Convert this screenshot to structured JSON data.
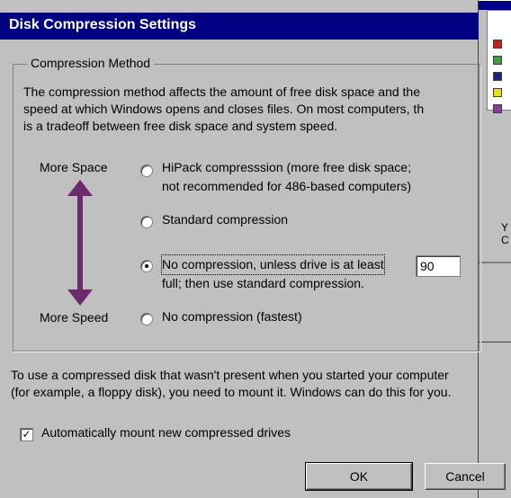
{
  "dialog": {
    "title": "Disk Compression Settings"
  },
  "group": {
    "label": "Compression Method",
    "description": [
      "The compression method affects the amount of free disk space and the",
      "speed at which Windows opens and closes files. On most computers, th",
      "is a tradeoff between free disk space and system speed."
    ],
    "more_space_label": "More Space",
    "more_speed_label": "More Speed",
    "options": [
      {
        "lines": [
          "HiPack compresssion (more free disk space;",
          "not recommended for 486-based computers)"
        ],
        "selected": false
      },
      {
        "lines": [
          "Standard compression"
        ],
        "selected": false
      },
      {
        "lines": [
          "No compression, unless drive is at least",
          "full; then use standard compression."
        ],
        "selected": true
      },
      {
        "lines": [
          "No compression (fastest)"
        ],
        "selected": false
      }
    ],
    "threshold_value": "90"
  },
  "mount_text": [
    "To use a compressed disk that wasn't present when you started your computer",
    "(for example, a floppy disk), you need to mount it. Windows can do this for you."
  ],
  "auto_mount": {
    "label": "Automatically mount new compressed drives",
    "checked": true
  },
  "buttons": {
    "ok": "OK",
    "cancel": "Cancel"
  },
  "background_window": {
    "text_lines": [
      "Y",
      "C"
    ]
  },
  "colors": {
    "titlebar": "#000080",
    "face": "#c0c0c0",
    "arrow": "#6b2a6b"
  }
}
